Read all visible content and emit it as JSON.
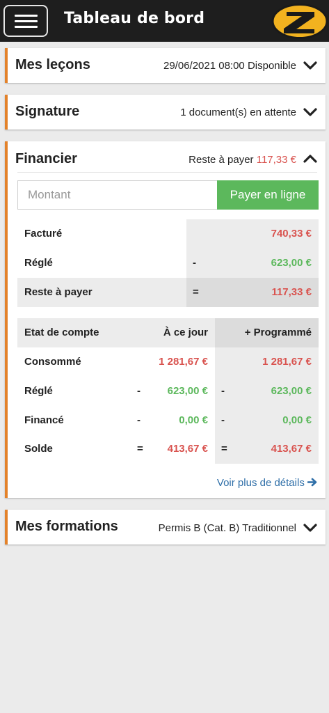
{
  "header": {
    "title": "Tableau de bord",
    "menu_icon": "hamburger-icon",
    "logo_icon": "z-logo-icon",
    "logo_letter": "Z",
    "logo_color": "#f2b21f"
  },
  "colors": {
    "accent": "#e3822a",
    "header_bg": "#1e1e1e",
    "red": "#d9534f",
    "green": "#5cb85c",
    "link": "#2f6fa8"
  },
  "lecons": {
    "title": "Mes leçons",
    "info": "29/06/2021 08:00 Disponible",
    "icon": "chevron-down-icon"
  },
  "signature": {
    "title": "Signature",
    "info": "1 document(s) en attente",
    "icon": "chevron-down-icon"
  },
  "financier": {
    "title": "Financier",
    "reste_label": "Reste à payer",
    "reste_value": "117,33 €",
    "icon": "chevron-up-icon",
    "montant_placeholder": "Montant",
    "pay_button": "Payer en ligne",
    "summary": {
      "facture_label": "Facturé",
      "facture_value": "740,33 €",
      "regle_label": "Réglé",
      "regle_op": "-",
      "regle_value": "623,00 €",
      "reste_label": "Reste à payer",
      "reste_op": "=",
      "reste_value": "117,33 €"
    },
    "account": {
      "header_label": "Etat de compte",
      "col_today": "À ce jour",
      "col_programmed": "+ Programmé",
      "rows": [
        {
          "label": "Consommé",
          "op_today": "",
          "today": "1 281,67 €",
          "op_prog": "",
          "prog": "1 281,67 €"
        },
        {
          "label": "Réglé",
          "op_today": "-",
          "today": "623,00 €",
          "op_prog": "-",
          "prog": "623,00 €"
        },
        {
          "label": "Financé",
          "op_today": "-",
          "today": "0,00 €",
          "op_prog": "-",
          "prog": "0,00 €"
        },
        {
          "label": "Solde",
          "op_today": "=",
          "today": "413,67 €",
          "op_prog": "=",
          "prog": "413,67 €"
        }
      ]
    },
    "details_link": "Voir plus de détails",
    "details_icon": "arrow-right-icon"
  },
  "formations": {
    "title": "Mes formations",
    "info": "Permis B (Cat. B) Traditionnel",
    "icon": "chevron-down-icon"
  }
}
